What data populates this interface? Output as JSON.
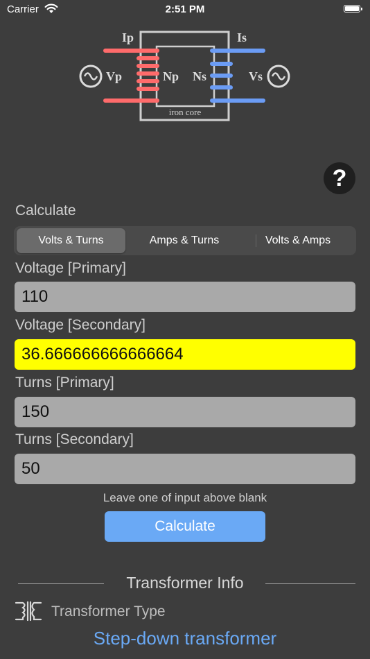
{
  "status_bar": {
    "carrier": "Carrier",
    "time": "2:51 PM"
  },
  "diagram": {
    "ip": "Ip",
    "is": "Is",
    "vp": "Vp",
    "vs": "Vs",
    "np": "Np",
    "ns": "Ns",
    "core": "iron core",
    "primary_color": "#ff6b6b",
    "secondary_color": "#6b9cf5",
    "core_color": "#cfcfcf"
  },
  "help": {
    "label": "?"
  },
  "calculate": {
    "label": "Calculate",
    "tabs": [
      {
        "label": "Volts & Turns",
        "selected": true
      },
      {
        "label": "Amps & Turns",
        "selected": false
      },
      {
        "label": "Volts & Amps",
        "selected": false
      }
    ]
  },
  "fields": {
    "voltage_primary": {
      "label": "Voltage [Primary]",
      "value": "110"
    },
    "voltage_secondary": {
      "label": "Voltage [Secondary]",
      "value": "36.666666666666664"
    },
    "turns_primary": {
      "label": "Turns [Primary]",
      "value": "150"
    },
    "turns_secondary": {
      "label": "Turns [Secondary]",
      "value": "50"
    }
  },
  "hint": "Leave one of input above blank",
  "calculate_button": "Calculate",
  "info": {
    "title": "Transformer Info",
    "type_label": "Transformer Type",
    "type_value": "Step-down transformer"
  },
  "colors": {
    "highlight": "#ffff00",
    "accent": "#6aa9f5",
    "background": "#3d3d3d"
  }
}
